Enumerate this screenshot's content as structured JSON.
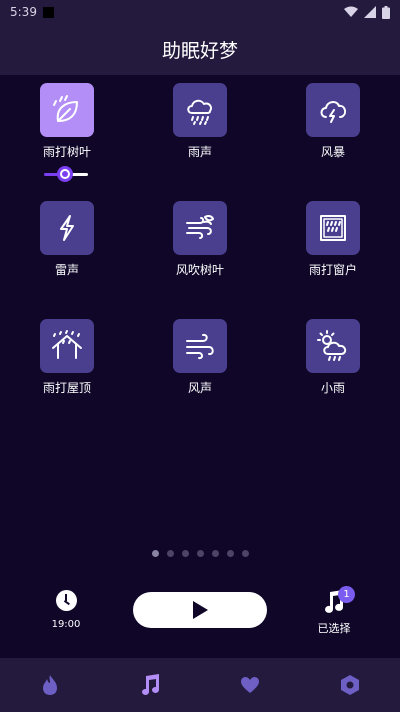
{
  "status": {
    "time": "5:39"
  },
  "header": {
    "title": "助眠好梦"
  },
  "sounds": [
    {
      "label": "雨打树叶",
      "icon": "leaf-rain-icon",
      "active": true
    },
    {
      "label": "雨声",
      "icon": "cloud-rain-icon",
      "active": false
    },
    {
      "label": "风暴",
      "icon": "storm-icon",
      "active": false
    },
    {
      "label": "雷声",
      "icon": "lightning-icon",
      "active": false
    },
    {
      "label": "风吹树叶",
      "icon": "wind-leaf-icon",
      "active": false
    },
    {
      "label": "雨打窗户",
      "icon": "rain-window-icon",
      "active": false
    },
    {
      "label": "雨打屋顶",
      "icon": "rain-roof-icon",
      "active": false
    },
    {
      "label": "风声",
      "icon": "wind-icon",
      "active": false
    },
    {
      "label": "小雨",
      "icon": "sun-cloud-rain-icon",
      "active": false
    }
  ],
  "volume": {
    "level": 0.45
  },
  "pager": {
    "count": 7,
    "current": 0
  },
  "player": {
    "timer_label": "19:00",
    "selected_label": "已选择",
    "selected_count": "1"
  },
  "colors": {
    "background": "#0f0628",
    "bar": "#241a3d",
    "tile": "#4a3f8f",
    "tile_active": "#b48ef7",
    "accent": "#7b3ff2",
    "nav_icon": "#6d5fc4",
    "nav_icon_active": "#b48ef7"
  },
  "nav": [
    {
      "name": "nav-flame",
      "icon": "flame-icon"
    },
    {
      "name": "nav-music",
      "icon": "music-note-icon"
    },
    {
      "name": "nav-favorites",
      "icon": "heart-icon"
    },
    {
      "name": "nav-settings",
      "icon": "hexagon-settings-icon"
    }
  ]
}
